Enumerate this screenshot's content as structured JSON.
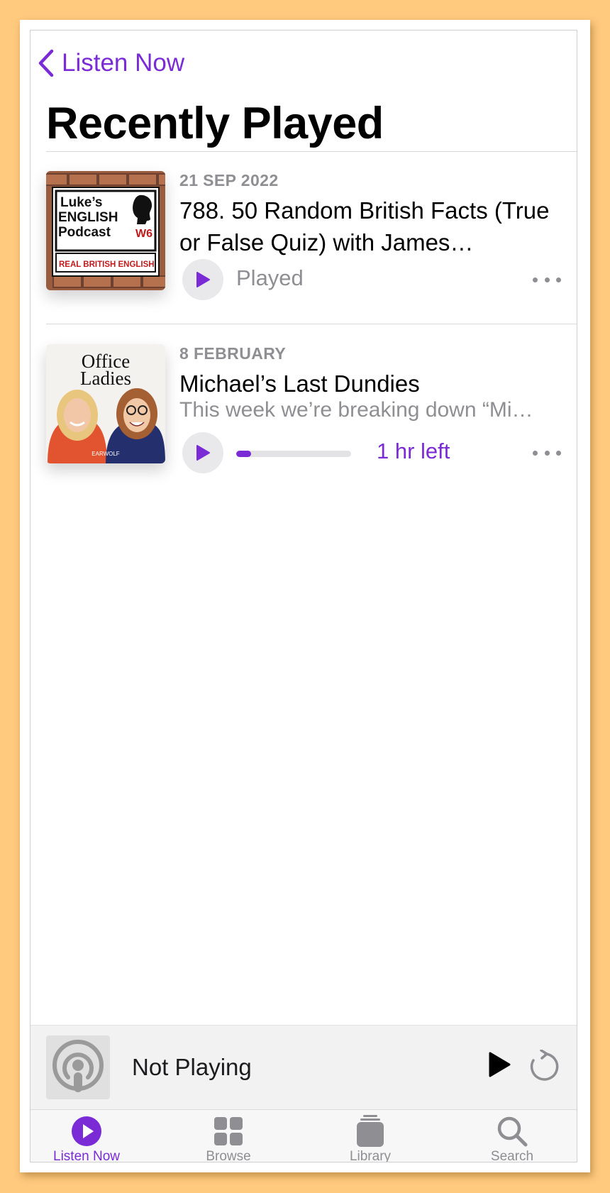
{
  "nav": {
    "back_label": "Listen Now"
  },
  "page": {
    "title": "Recently Played"
  },
  "episodes": [
    {
      "date": "21 SEP 2022",
      "title": "788. 50 Random British Facts (True or False Quiz) with James…",
      "status": "Played",
      "artwork": {
        "show_name_lines": [
          "Luke’s",
          "ENGLISH",
          "Podcast"
        ],
        "sign_code": "W6",
        "tagline": "REAL BRITISH ENGLISH"
      }
    },
    {
      "date": "8 FEBRUARY",
      "title": "Michael’s Last Dundies",
      "description": "This week we’re breaking down “Mi…",
      "progress": 0.13,
      "time_left": "1 hr left",
      "artwork": {
        "show_name_lines": [
          "Office",
          "Ladies"
        ],
        "publisher": "EARWOLF"
      }
    }
  ],
  "mini_player": {
    "title": "Not Playing"
  },
  "tabs": [
    {
      "label": "Listen Now",
      "icon": "play-circle-icon",
      "active": true
    },
    {
      "label": "Browse",
      "icon": "grid-icon",
      "active": false
    },
    {
      "label": "Library",
      "icon": "stack-icon",
      "active": false
    },
    {
      "label": "Search",
      "icon": "magnifier-icon",
      "active": false
    }
  ],
  "colors": {
    "accent": "#7B2BD6",
    "background": "#FFC97E",
    "secondary_text": "#8E8E93"
  }
}
